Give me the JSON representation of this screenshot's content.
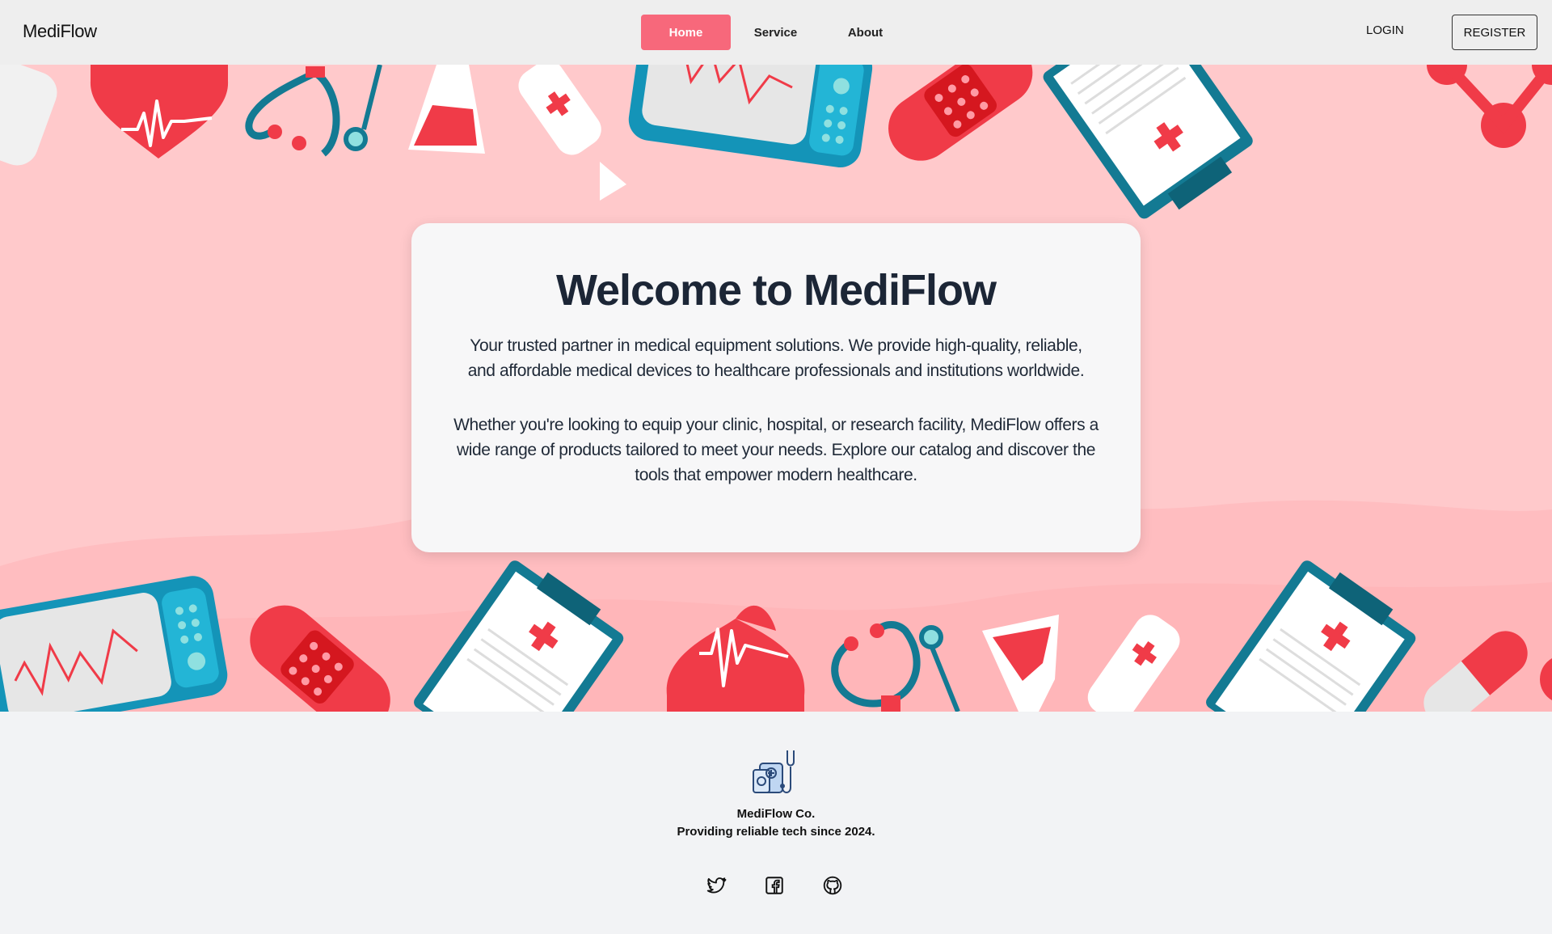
{
  "nav": {
    "brand": "MediFlow",
    "links": [
      {
        "label": "Home",
        "active": true
      },
      {
        "label": "Service",
        "active": false
      },
      {
        "label": "About",
        "active": false
      }
    ],
    "login_label": "LOGIN",
    "register_label": "REGISTER"
  },
  "hero": {
    "title": "Welcome to MediFlow",
    "paragraph1": "Your trusted partner in medical equipment solutions. We provide high-quality, reliable, and affordable medical devices to healthcare professionals and institutions worldwide.",
    "paragraph2": "Whether you're looking to equip your clinic, hospital, or research facility, MediFlow offers a wide range of products tailored to meet your needs. Explore our catalog and discover the tools that empower modern healthcare."
  },
  "footer": {
    "company": "MediFlow Co.",
    "tagline": "Providing reliable tech since 2024.",
    "social_icons": [
      "twitter-icon",
      "facebook-icon",
      "github-icon"
    ]
  },
  "colors": {
    "accent": "#f7687b",
    "hero_bg": "#ffc9cb",
    "red": "#f2374a",
    "teal": "#137a93"
  }
}
